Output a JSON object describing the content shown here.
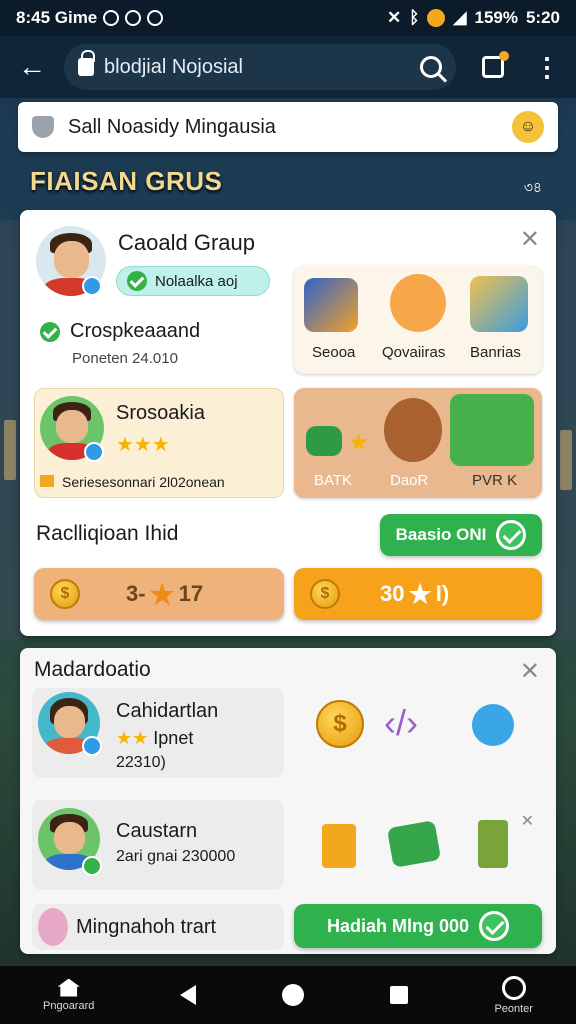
{
  "status_bar": {
    "left_text": "8:45 Gime",
    "battery": "159%",
    "time": "5:20"
  },
  "browser": {
    "url": "blodjial Nojosial"
  },
  "notice": {
    "text": "Sall Noasidy Mingausia"
  },
  "section": {
    "title": "FIAISAN GRUS",
    "more": "৩৪"
  },
  "group_card": {
    "title": "Caoald Graup",
    "badge": "Nolaalka aoj",
    "member1": {
      "name": "Crospkeaaand",
      "sub": "Poneten 24.010"
    },
    "member2": {
      "name": "Srosoakia",
      "sub": "Seriesesonnari 2l02onean"
    },
    "tiles_top": [
      "Seooa",
      "Qovaiiras",
      "Banrias"
    ],
    "tiles_bottom": [
      "BATK",
      "DaoR",
      "PVR K"
    ],
    "action_label": "Raclliqioan Ihid",
    "action_button": "Baasio ONI",
    "bar_left": "3-",
    "bar_left_num": "17",
    "bar_right": "30",
    "bar_right_tail": "I)"
  },
  "second_card": {
    "title": "Madardoatio",
    "row1": {
      "name": "Cahidartlan",
      "stars_text": "Ipnet",
      "sub": "22310)"
    },
    "row2": {
      "name": "Caustarn",
      "sub": "2ari gnai 230000"
    },
    "row3": {
      "name": "Mingnahoh trart",
      "button": "Hadiah Mlng 000"
    }
  },
  "nav": {
    "left": "Pngoarard",
    "right": "Peonter"
  },
  "colors": {
    "green": "#2fb24d",
    "orange": "#f7a21b",
    "peach": "#efb27a",
    "title_gold": "#f3d98f"
  }
}
